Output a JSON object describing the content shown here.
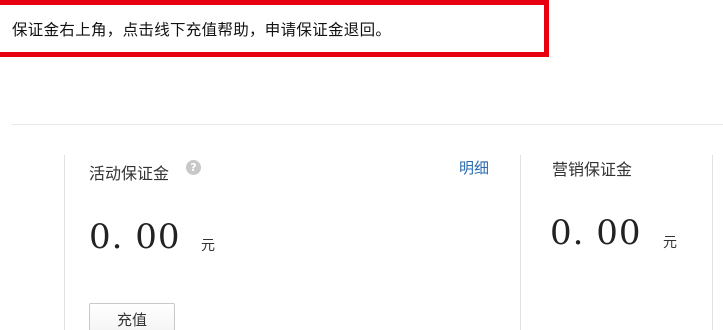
{
  "annotation": {
    "text": "保证金右上角，点击线下充值帮助，申请保证金退回。",
    "border_color": "#e60012"
  },
  "active_deposit": {
    "title": "活动保证金",
    "help_icon": "question-mark",
    "detail_link": "明细",
    "amount": "0. 00",
    "unit": "元",
    "recharge_button": "充值"
  },
  "marketing_deposit": {
    "title": "营销保证金",
    "amount": "0. 00",
    "unit": "元"
  },
  "colors": {
    "link": "#2b6cb0",
    "help_icon_bg": "#c8c8c8"
  }
}
